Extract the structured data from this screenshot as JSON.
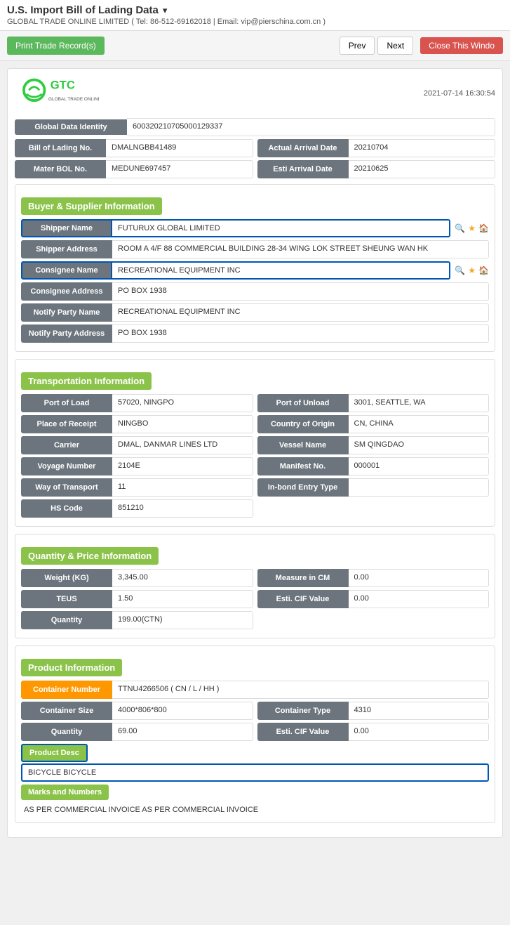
{
  "page": {
    "title": "U.S. Import Bill of Lading Data",
    "title_icon": "▾",
    "company_info": "GLOBAL TRADE ONLINE LIMITED ( Tel: 86-512-69162018 | Email: vip@pierschina.com.cn )"
  },
  "toolbar": {
    "print_label": "Print Trade Record(s)",
    "prev_label": "Prev",
    "next_label": "Next",
    "close_label": "Close This Windo"
  },
  "header": {
    "timestamp": "2021-07-14 16:30:54"
  },
  "basic_info": {
    "global_data_identity_label": "Global Data Identity",
    "global_data_identity_value": "600320210705000129337",
    "bill_of_lading_no_label": "Bill of Lading No.",
    "bill_of_lading_no_value": "DMALNGBB41489",
    "actual_arrival_date_label": "Actual Arrival Date",
    "actual_arrival_date_value": "20210704",
    "mater_bol_no_label": "Mater BOL No.",
    "mater_bol_no_value": "MEDUNE697457",
    "esti_arrival_date_label": "Esti Arrival Date",
    "esti_arrival_date_value": "20210625"
  },
  "buyer_supplier": {
    "section_title": "Buyer & Supplier Information",
    "shipper_name_label": "Shipper Name",
    "shipper_name_value": "FUTURUX GLOBAL LIMITED",
    "shipper_address_label": "Shipper Address",
    "shipper_address_value": "ROOM A 4/F 88 COMMERCIAL BUILDING 28-34 WING LOK STREET SHEUNG WAN HK",
    "consignee_name_label": "Consignee Name",
    "consignee_name_value": "RECREATIONAL EQUIPMENT INC",
    "consignee_address_label": "Consignee Address",
    "consignee_address_value": "PO BOX 1938",
    "notify_party_name_label": "Notify Party Name",
    "notify_party_name_value": "RECREATIONAL EQUIPMENT INC",
    "notify_party_address_label": "Notify Party Address",
    "notify_party_address_value": "PO BOX 1938"
  },
  "transportation": {
    "section_title": "Transportation Information",
    "port_of_load_label": "Port of Load",
    "port_of_load_value": "57020, NINGPO",
    "port_of_unload_label": "Port of Unload",
    "port_of_unload_value": "3001, SEATTLE, WA",
    "place_of_receipt_label": "Place of Receipt",
    "place_of_receipt_value": "NINGBO",
    "country_of_origin_label": "Country of Origin",
    "country_of_origin_value": "CN, CHINA",
    "carrier_label": "Carrier",
    "carrier_value": "DMAL, DANMAR LINES LTD",
    "vessel_name_label": "Vessel Name",
    "vessel_name_value": "SM QINGDAO",
    "voyage_number_label": "Voyage Number",
    "voyage_number_value": "2104E",
    "manifest_no_label": "Manifest No.",
    "manifest_no_value": "000001",
    "way_of_transport_label": "Way of Transport",
    "way_of_transport_value": "11",
    "in_bond_entry_type_label": "In-bond Entry Type",
    "in_bond_entry_type_value": "",
    "hs_code_label": "HS Code",
    "hs_code_value": "851210"
  },
  "quantity_price": {
    "section_title": "Quantity & Price Information",
    "weight_kg_label": "Weight (KG)",
    "weight_kg_value": "3,345.00",
    "measure_in_cm_label": "Measure in CM",
    "measure_in_cm_value": "0.00",
    "teus_label": "TEUS",
    "teus_value": "1.50",
    "esti_cif_value_label": "Esti. CIF Value",
    "esti_cif_value_value": "0.00",
    "quantity_label": "Quantity",
    "quantity_value": "199.00(CTN)"
  },
  "product_information": {
    "section_title": "Product Information",
    "container_number_label": "Container Number",
    "container_number_value": "TTNU4266506 ( CN / L / HH )",
    "container_size_label": "Container Size",
    "container_size_value": "4000*806*800",
    "container_type_label": "Container Type",
    "container_type_value": "4310",
    "quantity_label": "Quantity",
    "quantity_value": "69.00",
    "esti_cif_value_label": "Esti. CIF Value",
    "esti_cif_value_value": "0.00",
    "product_desc_label": "Product Desc",
    "product_desc_value": "BICYCLE BICYCLE",
    "marks_and_numbers_label": "Marks and Numbers",
    "marks_and_numbers_value": "AS PER COMMERCIAL INVOICE AS PER COMMERCIAL INVOICE"
  }
}
